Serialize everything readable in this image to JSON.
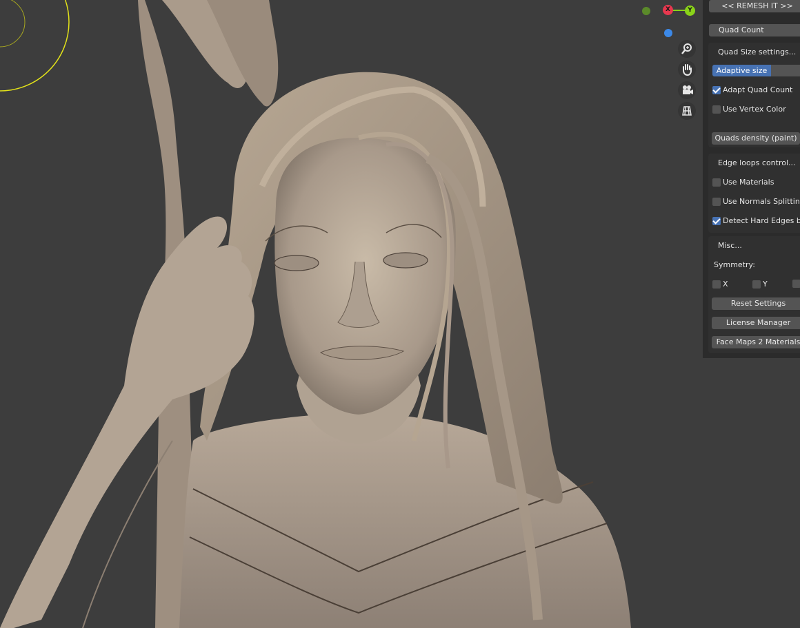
{
  "panel": {
    "header_button": "<<  REMESH IT  >>",
    "quad_count": "Quad Count",
    "quad_size_group": {
      "title": "Quad Size settings...",
      "adaptive_size": "Adaptive size",
      "adapt_quad_count": {
        "label": "Adapt Quad Count",
        "checked": true
      },
      "use_vertex_color": {
        "label": "Use Vertex Color",
        "checked": false
      },
      "quads_density": "Quads density (paint)"
    },
    "edge_loops_group": {
      "title": "Edge loops control...",
      "use_materials": {
        "label": "Use Materials",
        "checked": false
      },
      "use_normals_splitting": {
        "label": "Use Normals Splitting",
        "checked": false
      },
      "detect_hard_edges": {
        "label": "Detect Hard Edges by",
        "checked": true
      }
    },
    "misc_group": {
      "title": "Misc...",
      "symmetry_label": "Symmetry:",
      "sym_x": {
        "label": "X",
        "checked": false
      },
      "sym_y": {
        "label": "Y",
        "checked": false
      },
      "sym_z": {
        "label": "",
        "checked": false
      },
      "reset_settings": "Reset Settings",
      "license_manager": "License Manager",
      "face_maps": "Face Maps 2 Materials"
    }
  },
  "gizmo": {
    "x_label": "X",
    "y_label": "Y",
    "colors": {
      "x": "#e8384f",
      "y": "#8ad319",
      "z": "#3c89e8",
      "neg_y": "#5b8a2a"
    }
  },
  "nav_icons": [
    "zoom-icon",
    "hand-pan-icon",
    "camera-icon",
    "grid-ortho-icon"
  ]
}
